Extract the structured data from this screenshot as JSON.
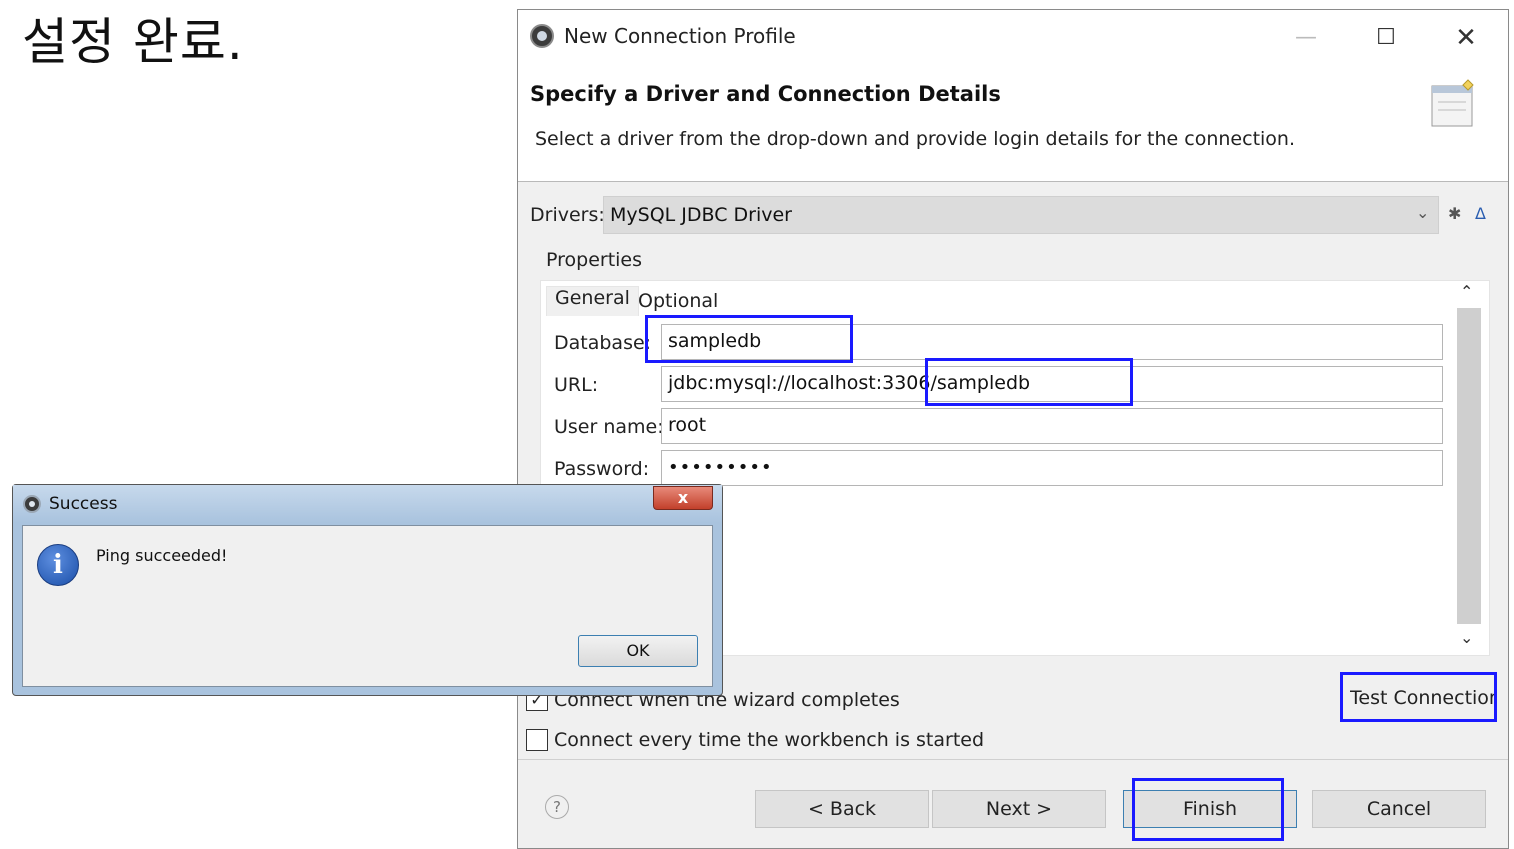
{
  "caption": "설정 완료.",
  "window": {
    "title": "New Connection Profile",
    "icon": "eclipse-icon",
    "controls": {
      "minimize": "—",
      "maximize": "☐",
      "close": "✕"
    }
  },
  "header": {
    "title": "Specify a Driver and Connection Details",
    "description": "Select a driver from the drop-down and provide login details for the connection."
  },
  "drivers": {
    "label": "Drivers:",
    "selected": "MySQL JDBC Driver",
    "tool_icons": [
      "new-driver-icon",
      "edit-driver-icon"
    ]
  },
  "properties": {
    "label": "Properties",
    "tabs": [
      "General",
      "Optional"
    ],
    "fields": {
      "database": {
        "label": "Database:",
        "value": "sampledb"
      },
      "url": {
        "label": "URL:",
        "value": "jdbc:mysql://localhost:3306/sampledb"
      },
      "username": {
        "label": "User name:",
        "value": "root"
      },
      "password": {
        "label": "Password:",
        "value": "•••••••••"
      }
    }
  },
  "options": {
    "connect_on_complete": {
      "label": "Connect when the wizard completes",
      "checked": true
    },
    "connect_every_time": {
      "label": "Connect every time the workbench is started",
      "checked": false
    }
  },
  "test_connection": "Test Connection",
  "footer": {
    "help": "?",
    "back": "< Back",
    "next": "Next >",
    "finish": "Finish",
    "cancel": "Cancel"
  },
  "success_dialog": {
    "title": "Success",
    "close": "x",
    "message": "Ping succeeded!",
    "ok": "OK",
    "icon": "info-icon"
  },
  "colors": {
    "highlight": "#1a1aff"
  }
}
